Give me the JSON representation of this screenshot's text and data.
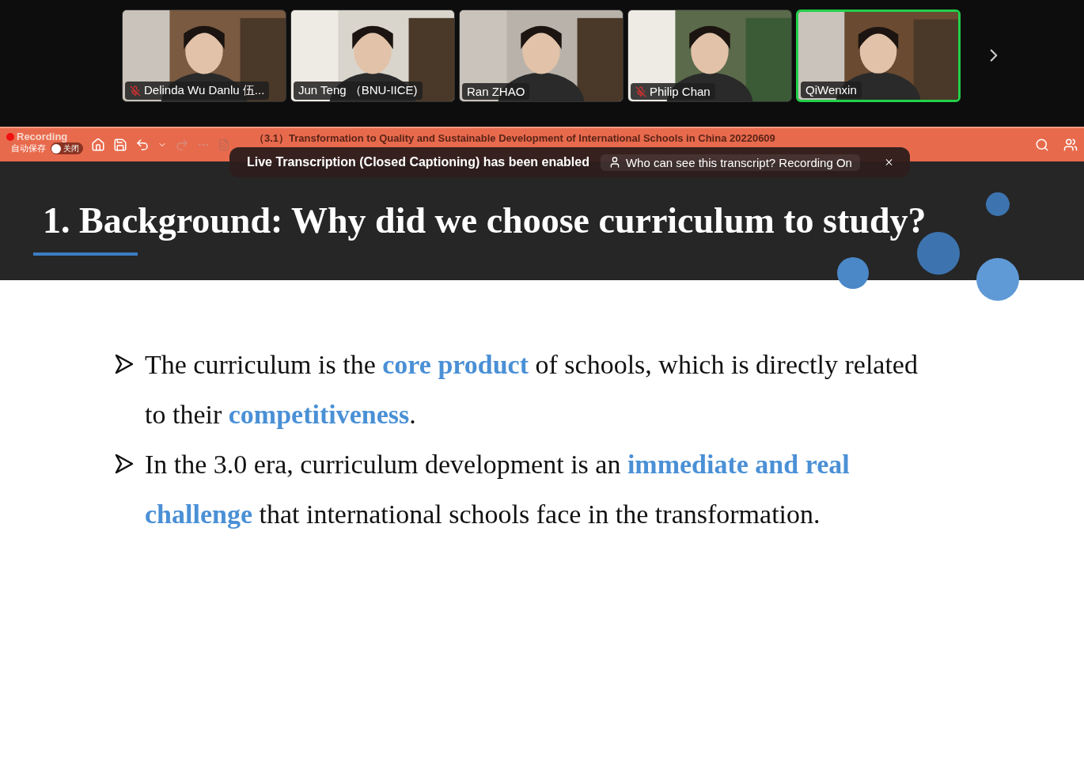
{
  "participants": [
    {
      "name": "Delinda Wu Danlu 伍...",
      "muted": true,
      "selected": false,
      "kind": "picture"
    },
    {
      "name": "Jun Teng （BNU-IICE)",
      "muted": false,
      "selected": false,
      "kind": "picture"
    },
    {
      "name": "Ran ZHAO",
      "muted": false,
      "selected": false,
      "kind": "picture"
    },
    {
      "name": "Philip Chan",
      "muted": true,
      "selected": false,
      "kind": "picture"
    },
    {
      "name": "QiWenxin",
      "muted": false,
      "selected": true,
      "kind": "picture"
    }
  ],
  "recording": {
    "label": "Recording"
  },
  "autosave": {
    "label": "自动保存",
    "toggle_label": "关闭",
    "on": false
  },
  "document_title": "（3.1）Transformation to Quality and Sustainable Development of International Schools in China 20220609",
  "banner": {
    "message": "Live Transcription (Closed Captioning) has been enabled",
    "link": "Who can see this transcript? Recording On"
  },
  "slide": {
    "title": "1. Background: Why did we choose curriculum to study?",
    "bullets": [
      "The curriculum is the **core product** of schools, which is directly related to their **competitiveness**.",
      "In the 3.0 era, curriculum development is an **immediate and real challenge** that international schools face in the transformation."
    ]
  }
}
